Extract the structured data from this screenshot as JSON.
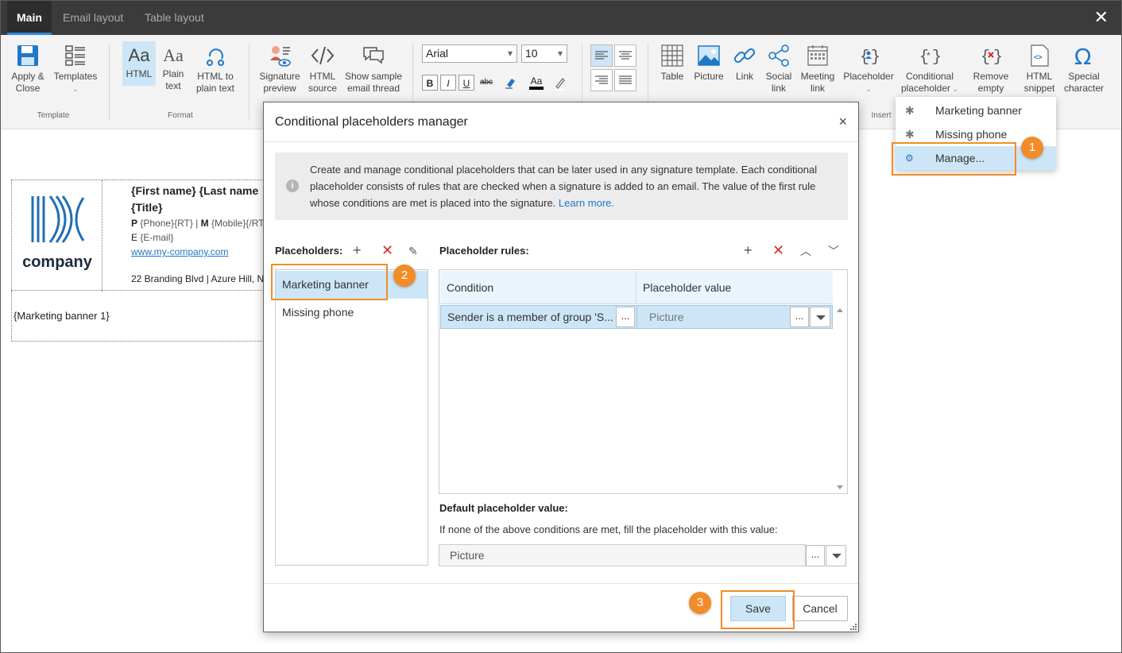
{
  "tabs": [
    {
      "label": "Main",
      "active": true
    },
    {
      "label": "Email layout",
      "active": false
    },
    {
      "label": "Table layout",
      "active": false
    }
  ],
  "window": {
    "close_icon": "close-icon"
  },
  "ribbon": {
    "template": {
      "label": "Template",
      "apply_close": [
        "Apply &",
        "Close"
      ],
      "templates": "Templates"
    },
    "format": {
      "label": "Format",
      "html": "HTML",
      "plain_text": [
        "Plain",
        "text"
      ],
      "html_to_plain": [
        "HTML to",
        "plain text"
      ]
    },
    "preview": {
      "signature_preview": [
        "Signature",
        "preview"
      ],
      "html_source": [
        "HTML",
        "source"
      ],
      "show_sample": [
        "Show sample",
        "email thread"
      ]
    },
    "font": {
      "family": "Arial",
      "size": "10"
    },
    "format_buttons": [
      "B",
      "I",
      "U",
      "abc"
    ],
    "insert": {
      "label": "Insert",
      "table": "Table",
      "picture": "Picture",
      "link": "Link",
      "social_link": [
        "Social",
        "link"
      ],
      "meeting_link": [
        "Meeting",
        "link"
      ],
      "placeholder": "Placeholder",
      "conditional_placeholder": [
        "Conditional",
        "placeholder"
      ],
      "remove_empty": [
        "Remove",
        "empty"
      ],
      "html_snippet": [
        "HTML",
        "snippet"
      ],
      "special_character": [
        "Special",
        "character"
      ]
    }
  },
  "signature": {
    "name_line": "{First name} {Last name",
    "title_line": "{Title}",
    "phone_line_p": "P",
    "phone_line_p_val": " {Phone}{RT} | ",
    "phone_line_m": "M",
    "phone_line_m_val": " {Mobile}{/RT",
    "email_line_e": "E",
    "email_line_val": " {E-mail}",
    "website": "www.my-company.com",
    "address": "22 Branding Blvd | Azure Hill, N",
    "logo_text": "company",
    "banner": "{Marketing banner 1}"
  },
  "dropdown_menu": {
    "items": [
      {
        "label": "Marketing banner",
        "icon": "asterisk-icon"
      },
      {
        "label": "Missing phone",
        "icon": "asterisk-icon"
      },
      {
        "label": "Manage...",
        "icon": "gear-icon",
        "highlighted": true
      }
    ]
  },
  "callouts": {
    "one": "1",
    "two": "2",
    "three": "3"
  },
  "dialog": {
    "title": "Conditional placeholders manager",
    "close": "×",
    "info_text": "Create and manage conditional placeholders that can be later used in any signature template. Each conditional placeholder consists of rules that are checked when a signature is added to an email. The value of the first rule whose conditions are met is placed into the signature.",
    "info_link": "Learn more.",
    "placeholders_label": "Placeholders:",
    "placeholders": [
      "Marketing banner",
      "Missing phone"
    ],
    "rules_label": "Placeholder rules:",
    "rules_columns": [
      "Condition",
      "Placeholder value"
    ],
    "rules": [
      {
        "condition": "Sender is a member of group 'S...",
        "value": "Picture"
      }
    ],
    "default_label": "Default placeholder value:",
    "default_desc": "If none of the above conditions are met, fill the placeholder with this value:",
    "default_value": "Picture",
    "ellipsis": "...",
    "save": "Save",
    "cancel": "Cancel"
  },
  "colors": {
    "accent": "#2b88d8",
    "callout": "#f28c28",
    "selection": "#cde6f7",
    "delete": "#d92b2b"
  }
}
